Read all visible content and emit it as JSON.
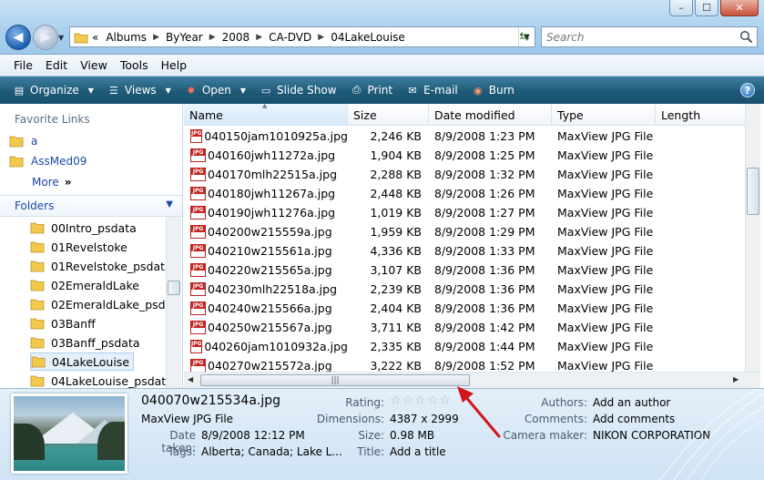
{
  "window": {
    "minimize_glyph": "–",
    "maximize_glyph": "☐",
    "close_glyph": "✕"
  },
  "address": {
    "overflow": "«",
    "breadcrumbs": [
      "Albums",
      "ByYear",
      "2008",
      "CA-DVD",
      "04LakeLouise"
    ]
  },
  "search": {
    "placeholder": "Search"
  },
  "menu": [
    "File",
    "Edit",
    "View",
    "Tools",
    "Help"
  ],
  "toolbar": {
    "organize": "Organize",
    "views": "Views",
    "open": "Open",
    "slideshow": "Slide Show",
    "print": "Print",
    "email": "E-mail",
    "burn": "Burn",
    "help": "?"
  },
  "nav": {
    "favorites_heading": "Favorite Links",
    "favorites": [
      "a",
      "AssMed09"
    ],
    "more": "More",
    "more_chevron": "»",
    "folders_heading": "Folders",
    "folders": [
      "00Intro_psdata",
      "01Revelstoke",
      "01Revelstoke_psdata",
      "02EmeraldLake",
      "02EmeraldLake_psdata",
      "03Banff",
      "03Banff_psdata",
      "04LakeLouise",
      "04LakeLouise_psdata"
    ],
    "selected_folder": "04LakeLouise"
  },
  "columns": {
    "name": "Name",
    "size": "Size",
    "date": "Date modified",
    "type": "Type",
    "length": "Length"
  },
  "files": [
    {
      "name": "040150jam1010925a.jpg",
      "size": "2,246 KB",
      "date": "8/9/2008 1:23 PM",
      "type": "MaxView JPG File"
    },
    {
      "name": "040160jwh11272a.jpg",
      "size": "1,904 KB",
      "date": "8/9/2008 1:25 PM",
      "type": "MaxView JPG File"
    },
    {
      "name": "040170mlh22515a.jpg",
      "size": "2,288 KB",
      "date": "8/9/2008 1:32 PM",
      "type": "MaxView JPG File"
    },
    {
      "name": "040180jwh11267a.jpg",
      "size": "2,448 KB",
      "date": "8/9/2008 1:26 PM",
      "type": "MaxView JPG File"
    },
    {
      "name": "040190jwh11276a.jpg",
      "size": "1,019 KB",
      "date": "8/9/2008 1:27 PM",
      "type": "MaxView JPG File"
    },
    {
      "name": "040200w215559a.jpg",
      "size": "1,959 KB",
      "date": "8/9/2008 1:29 PM",
      "type": "MaxView JPG File"
    },
    {
      "name": "040210w215561a.jpg",
      "size": "4,336 KB",
      "date": "8/9/2008 1:33 PM",
      "type": "MaxView JPG File"
    },
    {
      "name": "040220w215565a.jpg",
      "size": "3,107 KB",
      "date": "8/9/2008 1:36 PM",
      "type": "MaxView JPG File"
    },
    {
      "name": "040230mlh22518a.jpg",
      "size": "2,239 KB",
      "date": "8/9/2008 1:36 PM",
      "type": "MaxView JPG File"
    },
    {
      "name": "040240w215566a.jpg",
      "size": "2,404 KB",
      "date": "8/9/2008 1:36 PM",
      "type": "MaxView JPG File"
    },
    {
      "name": "040250w215567a.jpg",
      "size": "3,711 KB",
      "date": "8/9/2008 1:42 PM",
      "type": "MaxView JPG File"
    },
    {
      "name": "040260jam1010932a.jpg",
      "size": "2,335 KB",
      "date": "8/9/2008 1:44 PM",
      "type": "MaxView JPG File"
    },
    {
      "name": "040270w215572a.jpg",
      "size": "3,222 KB",
      "date": "8/9/2008 1:52 PM",
      "type": "MaxView JPG File"
    }
  ],
  "details": {
    "filename": "040070w215534a.jpg",
    "filetype": "MaxView JPG File",
    "date_taken_label": "Date taken:",
    "date_taken": "8/9/2008 12:12 PM",
    "tags_label": "Tags:",
    "tags": "Alberta; Canada; Lake L...",
    "rating_label": "Rating:",
    "rating": 0,
    "rating_max": 5,
    "dimensions_label": "Dimensions:",
    "dimensions": "4387 x 2999",
    "size_label": "Size:",
    "size": "0.98 MB",
    "title_label": "Title:",
    "title": "Add a title",
    "authors_label": "Authors:",
    "authors": "Add an author",
    "comments_label": "Comments:",
    "comments": "Add comments",
    "camera_label": "Camera maker:",
    "camera": "NIKON CORPORATION"
  },
  "colors": {
    "toolbar": "#1e5a78",
    "link": "#1c47a8",
    "annotation_arrow": "#d0151b"
  }
}
